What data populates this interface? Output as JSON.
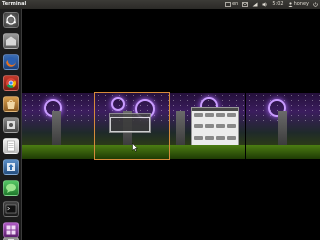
{
  "top_panel": {
    "app_title": "Terminal",
    "keyboard_layout": "en",
    "time": "5:02",
    "user": "honey"
  },
  "launcher": {
    "items": [
      {
        "name": "dash-home-icon",
        "color": "#666666"
      },
      {
        "name": "home-folder-icon",
        "color": "#8a8a8a"
      },
      {
        "name": "firefox-icon",
        "color": "#e8721c"
      },
      {
        "name": "chrome-icon",
        "color": "#3ba14b"
      },
      {
        "name": "software-center-icon",
        "color": "#c87530"
      },
      {
        "name": "system-settings-icon",
        "color": "#777777"
      },
      {
        "name": "text-editor-icon",
        "color": "#e8e8e8"
      },
      {
        "name": "update-manager-icon",
        "color": "#3a7bbd"
      },
      {
        "name": "messaging-icon",
        "color": "#3fb34f"
      },
      {
        "name": "terminal-icon",
        "color": "#2c2c2c"
      },
      {
        "name": "workspace-switcher-icon",
        "color": "#8c3aa0"
      },
      {
        "name": "trash-icon",
        "color": "#7a7a7a"
      }
    ]
  },
  "workspaces": {
    "count": 4,
    "selected_index": 1,
    "accent_color": "#d58a3a"
  }
}
